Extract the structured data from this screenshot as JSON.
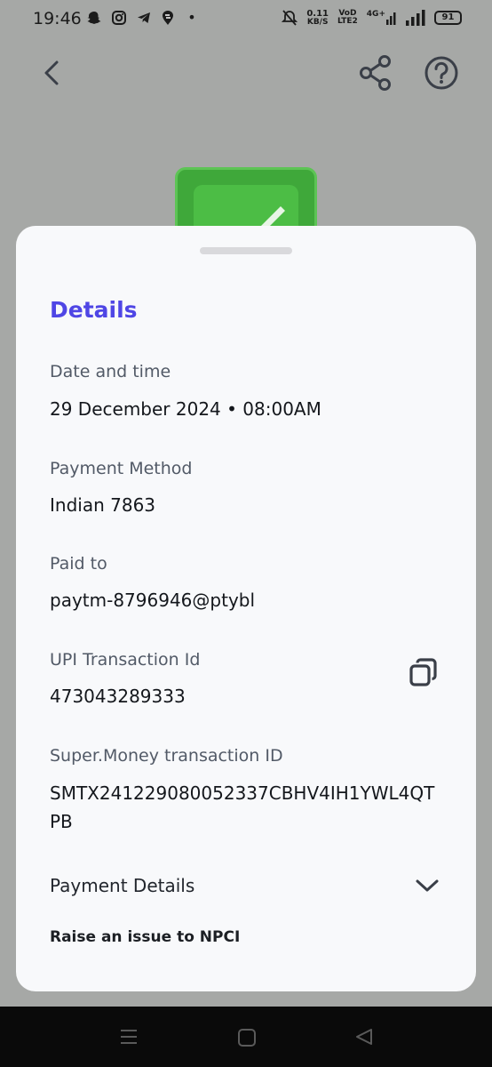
{
  "status_bar": {
    "time": "19:46",
    "notification_dot": "•",
    "net_speed_value": "0.11",
    "net_speed_unit": "KB/S",
    "net_tag_top": "VoD",
    "net_tag_bottom": "LTE2",
    "signal_label": "4G+",
    "battery": "91"
  },
  "icons": {
    "back": "chevron-left",
    "share": "share",
    "help": "question-circle",
    "copy": "copy",
    "expand": "chevron-down"
  },
  "details": {
    "title": "Details",
    "date_label": "Date and time",
    "date_value": "29 December 2024 • 08:00AM",
    "method_label": "Payment Method",
    "method_value": "Indian 7863",
    "paid_to_label": "Paid to",
    "paid_to_value": "paytm-8796946@ptybl",
    "upi_label": "UPI Transaction Id",
    "upi_value": "473043289333",
    "sm_label": "Super.Money transaction ID",
    "sm_value": "SMTX241229080052337CBHV4IH1YWL4QTPB",
    "payment_details": "Payment Details",
    "raise_issue": "Raise an issue to NPCI"
  },
  "colors": {
    "accent": "#4f46e5",
    "success_green": "#3fa83a",
    "overlay": "#a6a8a6"
  }
}
